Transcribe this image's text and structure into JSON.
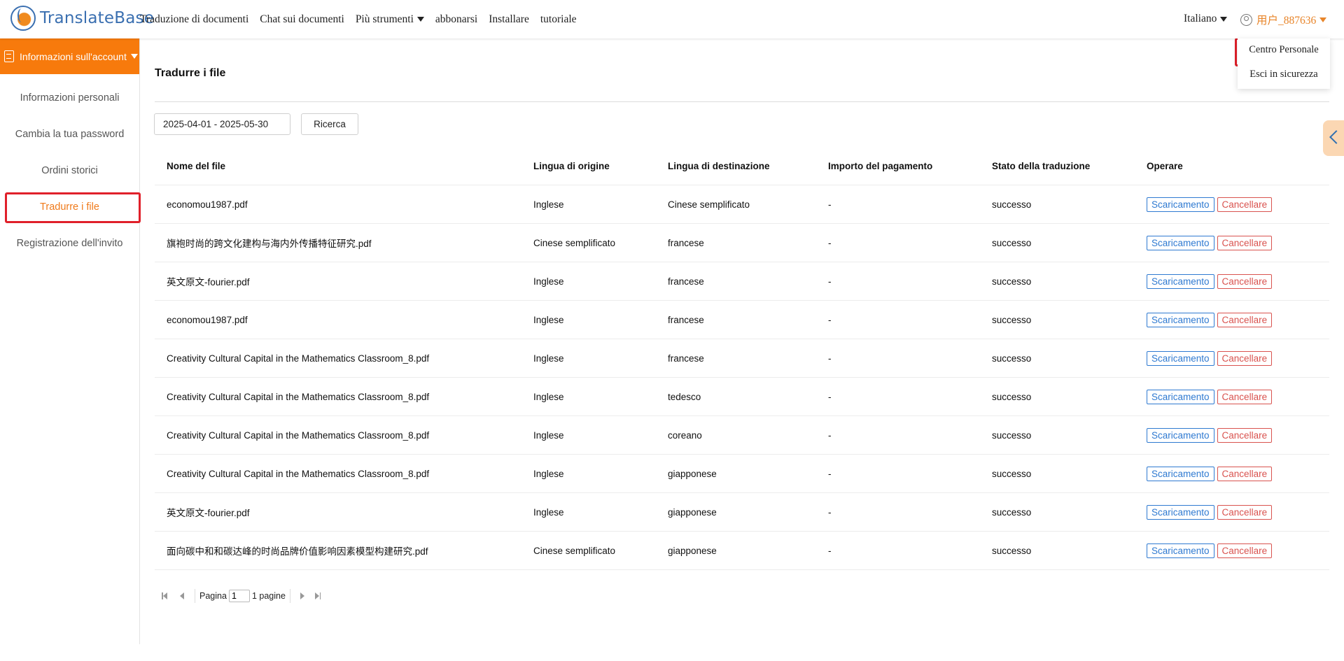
{
  "brand": {
    "name": "TranslateBase"
  },
  "nav": {
    "items": [
      "Traduzione di documenti",
      "Chat sui documenti",
      "Più strumenti",
      "abbonarsi",
      "Installare",
      "tutoriale"
    ],
    "language": "Italiano",
    "user": "用户_887636"
  },
  "user_dropdown": {
    "items": [
      "Centro Personale",
      "Esci in sicurezza"
    ]
  },
  "sidebar": {
    "header": "Informazioni sull'account",
    "items": [
      "Informazioni personali",
      "Cambia la tua password",
      "Ordini storici",
      "Tradurre i file",
      "Registrazione dell'invito"
    ]
  },
  "main": {
    "title": "Tradurre i file",
    "date_range": "2025-04-01 - 2025-05-30",
    "search_label": "Ricerca",
    "table": {
      "columns": [
        "Nome del file",
        "Lingua di origine",
        "Lingua di destinazione",
        "Importo del pagamento",
        "Stato della traduzione",
        "Operare"
      ],
      "download_label": "Scaricamento",
      "delete_label": "Cancellare",
      "rows": [
        [
          "economou1987.pdf",
          "Inglese",
          "Cinese semplificato",
          "-",
          "successo"
        ],
        [
          "旗袍时尚的跨文化建构与海内外传播特征研究.pdf",
          "Cinese semplificato",
          "francese",
          "-",
          "successo"
        ],
        [
          "英文原文-fourier.pdf",
          "Inglese",
          "francese",
          "-",
          "successo"
        ],
        [
          "economou1987.pdf",
          "Inglese",
          "francese",
          "-",
          "successo"
        ],
        [
          "Creativity Cultural Capital in the Mathematics Classroom_8.pdf",
          "Inglese",
          "francese",
          "-",
          "successo"
        ],
        [
          "Creativity Cultural Capital in the Mathematics Classroom_8.pdf",
          "Inglese",
          "tedesco",
          "-",
          "successo"
        ],
        [
          "Creativity Cultural Capital in the Mathematics Classroom_8.pdf",
          "Inglese",
          "coreano",
          "-",
          "successo"
        ],
        [
          "Creativity Cultural Capital in the Mathematics Classroom_8.pdf",
          "Inglese",
          "giapponese",
          "-",
          "successo"
        ],
        [
          "英文原文-fourier.pdf",
          "Inglese",
          "giapponese",
          "-",
          "successo"
        ],
        [
          "面向碳中和和碳达峰的时尚品牌价值影响因素模型构建研究.pdf",
          "Cinese semplificato",
          "giapponese",
          "-",
          "successo"
        ]
      ]
    }
  },
  "pagination": {
    "page_label": "Pagina",
    "page_value": "1",
    "total_label": "1 pagine"
  },
  "colors": {
    "accent": "#f77a0c",
    "highlight": "#e0202a",
    "download": "#2f7ad1",
    "delete": "#d9534f"
  }
}
